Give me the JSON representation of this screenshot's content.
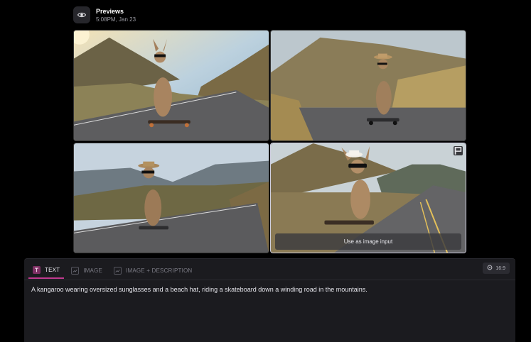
{
  "header": {
    "title": "Previews",
    "timestamp": "5:08PM, Jan 23",
    "icon": "eye-icon"
  },
  "grid": {
    "images": [
      {
        "id": "preview-1",
        "selected": false
      },
      {
        "id": "preview-2",
        "selected": false
      },
      {
        "id": "preview-3",
        "selected": false
      },
      {
        "id": "preview-4",
        "selected": true,
        "action_label": "Use as image input",
        "corner_icon": "flag-icon"
      }
    ]
  },
  "panel": {
    "tabs": [
      {
        "label": "TEXT",
        "active": true,
        "icon": "text-icon"
      },
      {
        "label": "IMAGE",
        "active": false,
        "icon": "image-icon"
      },
      {
        "label": "IMAGE + DESCRIPTION",
        "active": false,
        "icon": "image-description-icon"
      }
    ],
    "aspect_ratio": "16:9",
    "prompt": "A kangaroo wearing oversized sunglasses and a beach hat, riding a skateboard down a winding road in the mountains."
  },
  "colors": {
    "accent": "#c03a8f",
    "panel_bg": "#1b1b1f",
    "page_bg": "#000000"
  }
}
